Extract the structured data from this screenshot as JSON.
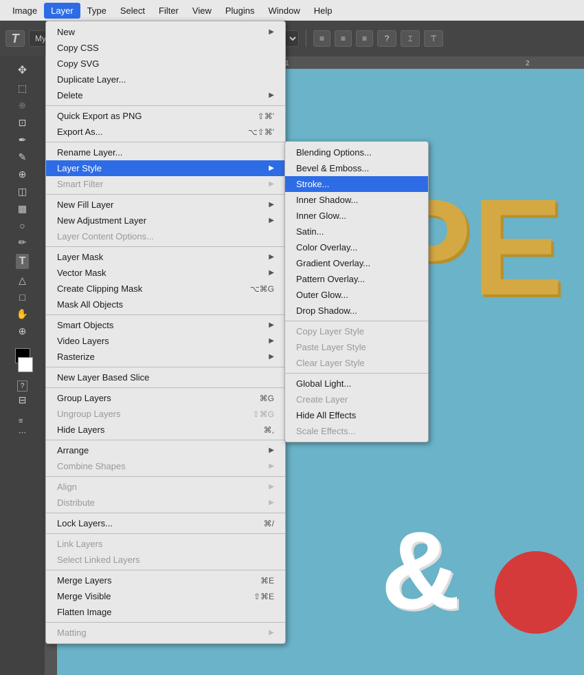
{
  "menubar": {
    "items": [
      {
        "id": "image",
        "label": "Image"
      },
      {
        "id": "layer",
        "label": "Layer",
        "active": true
      },
      {
        "id": "type",
        "label": "Type"
      },
      {
        "id": "select",
        "label": "Select"
      },
      {
        "id": "filter",
        "label": "Filter"
      },
      {
        "id": "view",
        "label": "View"
      },
      {
        "id": "plugins",
        "label": "Plugins"
      },
      {
        "id": "window",
        "label": "Window"
      },
      {
        "id": "help",
        "label": "Help"
      }
    ]
  },
  "layer_menu": {
    "items": [
      {
        "id": "new",
        "label": "New",
        "submenu": true,
        "disabled": false
      },
      {
        "id": "copy-css",
        "label": "Copy CSS",
        "submenu": false
      },
      {
        "id": "copy-svg",
        "label": "Copy SVG",
        "submenu": false
      },
      {
        "id": "duplicate-layer",
        "label": "Duplicate Layer...",
        "submenu": false
      },
      {
        "id": "delete",
        "label": "Delete",
        "submenu": true,
        "disabled": false
      },
      {
        "separator": true
      },
      {
        "id": "quick-export",
        "label": "Quick Export as PNG",
        "shortcut": "⇧⌘'"
      },
      {
        "id": "export-as",
        "label": "Export As...",
        "shortcut": "⌥⇧⌘'"
      },
      {
        "separator": true
      },
      {
        "id": "rename-layer",
        "label": "Rename Layer..."
      },
      {
        "id": "layer-style",
        "label": "Layer Style",
        "submenu": true,
        "highlighted": true
      },
      {
        "id": "smart-filter",
        "label": "Smart Filter",
        "submenu": true,
        "disabled": true
      },
      {
        "separator": true
      },
      {
        "id": "new-fill-layer",
        "label": "New Fill Layer",
        "submenu": true
      },
      {
        "id": "new-adjustment-layer",
        "label": "New Adjustment Layer",
        "submenu": true
      },
      {
        "id": "layer-content-options",
        "label": "Layer Content Options...",
        "disabled": true
      },
      {
        "separator": true
      },
      {
        "id": "layer-mask",
        "label": "Layer Mask",
        "submenu": true
      },
      {
        "id": "vector-mask",
        "label": "Vector Mask",
        "submenu": true
      },
      {
        "id": "create-clipping-mask",
        "label": "Create Clipping Mask",
        "shortcut": "⌥⌘G"
      },
      {
        "id": "mask-all-objects",
        "label": "Mask All Objects"
      },
      {
        "separator": true
      },
      {
        "id": "smart-objects",
        "label": "Smart Objects",
        "submenu": true
      },
      {
        "id": "video-layers",
        "label": "Video Layers",
        "submenu": true
      },
      {
        "id": "rasterize",
        "label": "Rasterize",
        "submenu": true
      },
      {
        "separator": true
      },
      {
        "id": "new-layer-based-slice",
        "label": "New Layer Based Slice"
      },
      {
        "separator": true
      },
      {
        "id": "group-layers",
        "label": "Group Layers",
        "shortcut": "⌘G"
      },
      {
        "id": "ungroup-layers",
        "label": "Ungroup Layers",
        "shortcut": "⇧⌘G",
        "disabled": true
      },
      {
        "id": "hide-layers",
        "label": "Hide Layers",
        "shortcut": "⌘,"
      },
      {
        "separator": true
      },
      {
        "id": "arrange",
        "label": "Arrange",
        "submenu": true
      },
      {
        "id": "combine-shapes",
        "label": "Combine Shapes",
        "submenu": true,
        "disabled": true
      },
      {
        "separator": true
      },
      {
        "id": "align",
        "label": "Align",
        "submenu": true,
        "disabled": true
      },
      {
        "id": "distribute",
        "label": "Distribute",
        "submenu": true,
        "disabled": true
      },
      {
        "separator": true
      },
      {
        "id": "lock-layers",
        "label": "Lock Layers...",
        "shortcut": "⌘/"
      },
      {
        "separator": true
      },
      {
        "id": "link-layers",
        "label": "Link Layers",
        "disabled": true
      },
      {
        "id": "select-linked-layers",
        "label": "Select Linked Layers",
        "disabled": true
      },
      {
        "separator": true
      },
      {
        "id": "merge-layers",
        "label": "Merge Layers",
        "shortcut": "⌘E"
      },
      {
        "id": "merge-visible",
        "label": "Merge Visible",
        "shortcut": "⇧⌘E"
      },
      {
        "id": "flatten-image",
        "label": "Flatten Image"
      },
      {
        "separator": true
      },
      {
        "id": "matting",
        "label": "Matting",
        "submenu": true,
        "disabled": true
      }
    ]
  },
  "layer_style_submenu": {
    "items": [
      {
        "id": "blending-options",
        "label": "Blending Options..."
      },
      {
        "id": "bevel-emboss",
        "label": "Bevel & Emboss..."
      },
      {
        "id": "stroke",
        "label": "Stroke...",
        "highlighted": true
      },
      {
        "id": "inner-shadow",
        "label": "Inner Shadow..."
      },
      {
        "id": "inner-glow",
        "label": "Inner Glow..."
      },
      {
        "id": "satin",
        "label": "Satin..."
      },
      {
        "id": "color-overlay",
        "label": "Color Overlay..."
      },
      {
        "id": "gradient-overlay",
        "label": "Gradient Overlay..."
      },
      {
        "id": "pattern-overlay",
        "label": "Pattern Overlay..."
      },
      {
        "id": "outer-glow",
        "label": "Outer Glow..."
      },
      {
        "id": "drop-shadow",
        "label": "Drop Shadow..."
      },
      {
        "separator": true
      },
      {
        "id": "copy-layer-style",
        "label": "Copy Layer Style",
        "disabled": true
      },
      {
        "id": "paste-layer-style",
        "label": "Paste Layer Style",
        "disabled": true
      },
      {
        "id": "clear-layer-style",
        "label": "Clear Layer Style",
        "disabled": true
      },
      {
        "separator": true
      },
      {
        "id": "global-light",
        "label": "Global Light..."
      },
      {
        "id": "create-layer",
        "label": "Create Layer",
        "disabled": true
      },
      {
        "id": "hide-all-effects",
        "label": "Hide All Effects"
      },
      {
        "id": "scale-effects",
        "label": "Scale Effects...",
        "disabled": true
      }
    ]
  },
  "canvas": {
    "text_pe": "PE",
    "text_amp": "&",
    "bg_color": "#6ab3c8"
  }
}
